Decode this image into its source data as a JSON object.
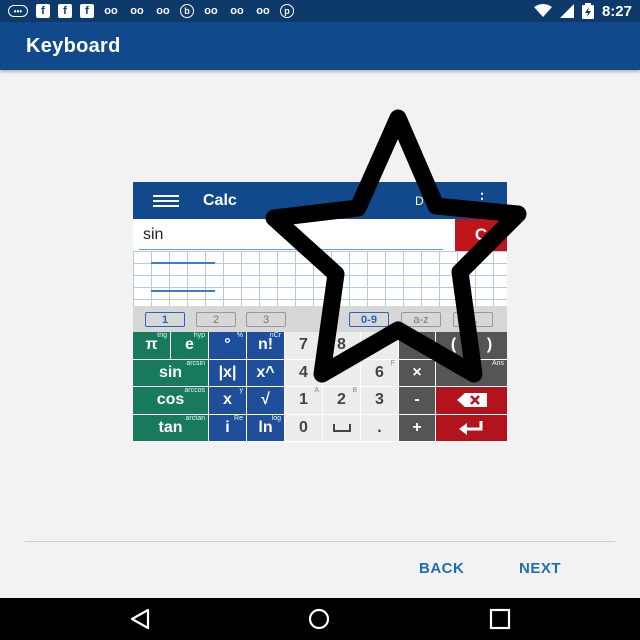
{
  "status_bar": {
    "left_icons": [
      "message-icon",
      "facebook-icon",
      "facebook-icon",
      "facebook-icon",
      "link-icon",
      "link-icon",
      "link-icon",
      "b-icon",
      "link-icon",
      "link-icon",
      "link-icon",
      "pinterest-icon"
    ],
    "time": "8:27"
  },
  "app_bar": {
    "title": "Keyboard"
  },
  "calculator": {
    "title": "Calc",
    "deg_label": "D",
    "input_text": "sin",
    "clear_label": "C",
    "tabs": [
      "1",
      "2",
      "3",
      "0-9",
      "a-z"
    ],
    "keys": {
      "pi": "π",
      "e": "e",
      "deg": "°",
      "fact": "n!",
      "sin": "sin",
      "abs": "|x|",
      "pow": "x^",
      "cos": "cos",
      "mul": "x",
      "sqrt": "√",
      "tan": "tan",
      "i": "i",
      "ln": "ln",
      "n7": "7",
      "n8": "8",
      "n4": "4",
      "n6": "6",
      "n1": "1",
      "n2": "2",
      "n3": "3",
      "n0": "0",
      "times": "×",
      "minus": "-",
      "plus": "+",
      "paren_open": "(",
      "paren_close": ")"
    },
    "sup_labels": {
      "trig": "trig",
      "hyp": "hyp",
      "pct": "%",
      "ncr": "nCr",
      "arcsin": "arcsin",
      "arccos": "arccos",
      "arctan": "arctan",
      "a": "A",
      "b": "B",
      "f": "F",
      "y": "y",
      "re": "Re",
      "log": "log",
      "ans": "Ans"
    }
  },
  "footer": {
    "back_label": "BACK",
    "next_label": "NEXT"
  },
  "colors": {
    "primary": "#114a8c",
    "accent": "#1f6fb0",
    "clear": "#c0141c"
  }
}
